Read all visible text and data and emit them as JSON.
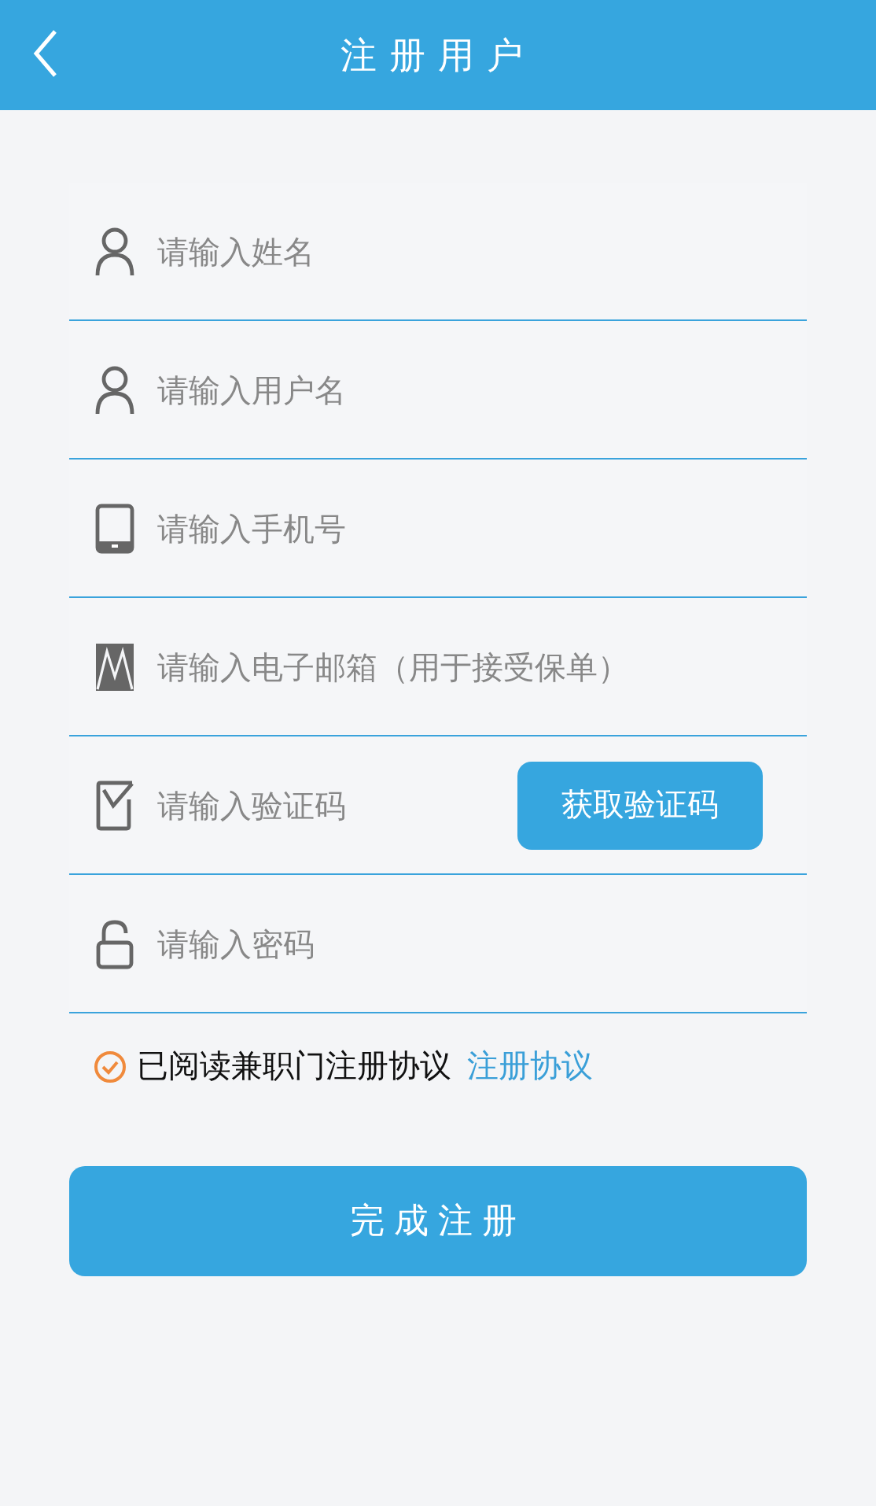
{
  "header": {
    "title": "注册用户"
  },
  "fields": [
    {
      "kind": "person",
      "placeholder": "请输入姓名"
    },
    {
      "kind": "person",
      "placeholder": "请输入用户名"
    },
    {
      "kind": "phone",
      "placeholder": "请输入手机号"
    },
    {
      "kind": "mail",
      "placeholder": "请输入电子邮箱（用于接受保单）"
    },
    {
      "kind": "code",
      "placeholder": "请输入验证码",
      "button": "获取验证码"
    },
    {
      "kind": "lock",
      "placeholder": "请输入密码"
    }
  ],
  "agreement": {
    "checked": true,
    "text": "已阅读兼职门注册协议",
    "link": "注册协议"
  },
  "submit": "完成注册"
}
